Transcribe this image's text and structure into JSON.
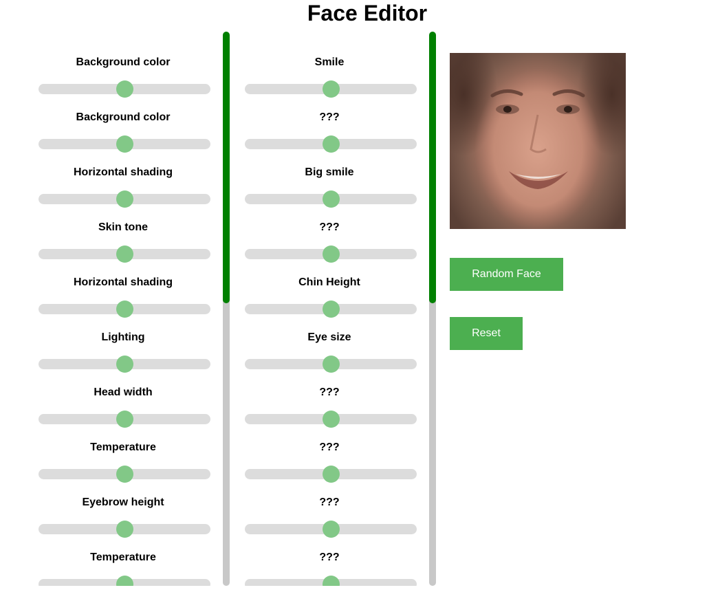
{
  "page": {
    "title": "Face Editor"
  },
  "left_panel": {
    "sliders": [
      {
        "label": "Background color",
        "value": 0.5
      },
      {
        "label": "Background color",
        "value": 0.5
      },
      {
        "label": "Horizontal shading",
        "value": 0.5
      },
      {
        "label": "Skin tone",
        "value": 0.5
      },
      {
        "label": "Horizontal shading",
        "value": 0.5
      },
      {
        "label": "Lighting",
        "value": 0.5
      },
      {
        "label": "Head width",
        "value": 0.5
      },
      {
        "label": "Temperature",
        "value": 0.5
      },
      {
        "label": "Eyebrow height",
        "value": 0.5
      },
      {
        "label": "Temperature",
        "value": 0.5
      }
    ]
  },
  "middle_panel": {
    "sliders": [
      {
        "label": "Smile",
        "value": 0.5
      },
      {
        "label": "???",
        "value": 0.5
      },
      {
        "label": "Big smile",
        "value": 0.5
      },
      {
        "label": "???",
        "value": 0.5
      },
      {
        "label": "Chin Height",
        "value": 0.5
      },
      {
        "label": "Eye size",
        "value": 0.5
      },
      {
        "label": "???",
        "value": 0.5
      },
      {
        "label": "???",
        "value": 0.5
      },
      {
        "label": "???",
        "value": 0.5
      },
      {
        "label": "???",
        "value": 0.5
      }
    ]
  },
  "scrollbars": {
    "scroll_fraction": 0.0,
    "visible_fraction": 0.49
  },
  "buttons": {
    "random_label": "Random Face",
    "reset_label": "Reset"
  },
  "colors": {
    "accent": "#4caf50",
    "slider_thumb": "#82c887",
    "slider_track": "#dcdcdc",
    "scroll_thumb": "#008000",
    "scroll_track": "#c8c8c8"
  },
  "image": {
    "subject": "generated-face"
  }
}
